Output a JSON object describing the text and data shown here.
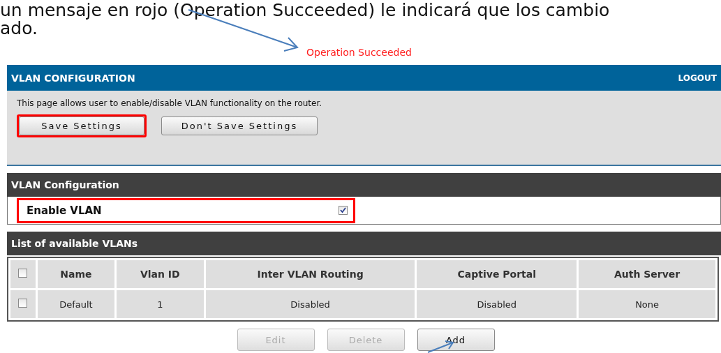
{
  "document_text": {
    "lines": [
      "un mensaje en rojo (Operation Succeeded) le indicará que los cambio",
      "ado."
    ]
  },
  "status_message": "Operation Succeeded",
  "panel": {
    "title": "VLAN CONFIGURATION",
    "logout": "LOGOUT",
    "description": "This page allows user to enable/disable VLAN functionality on the router.",
    "buttons": [
      {
        "label": "Save Settings",
        "highlighted": true
      },
      {
        "label": "Don't Save Settings",
        "highlighted": false
      }
    ]
  },
  "vlan_configuration": {
    "title": "VLAN Configuration",
    "enable_vlan": {
      "label": "Enable VLAN",
      "checked": true,
      "highlighted": true
    }
  },
  "vlan_list": {
    "title": "List of available VLANs",
    "select_all_checked": false,
    "columns": [
      "Name",
      "Vlan ID",
      "Inter VLAN Routing",
      "Captive Portal",
      "Auth Server"
    ],
    "rows": [
      {
        "checked": false,
        "cells": [
          "Default",
          "1",
          "Disabled",
          "Disabled",
          "None"
        ]
      }
    ]
  },
  "actions": [
    {
      "label": "Edit",
      "disabled": true
    },
    {
      "label": "Delete",
      "disabled": true
    },
    {
      "label": "Add",
      "disabled": false
    }
  ]
}
